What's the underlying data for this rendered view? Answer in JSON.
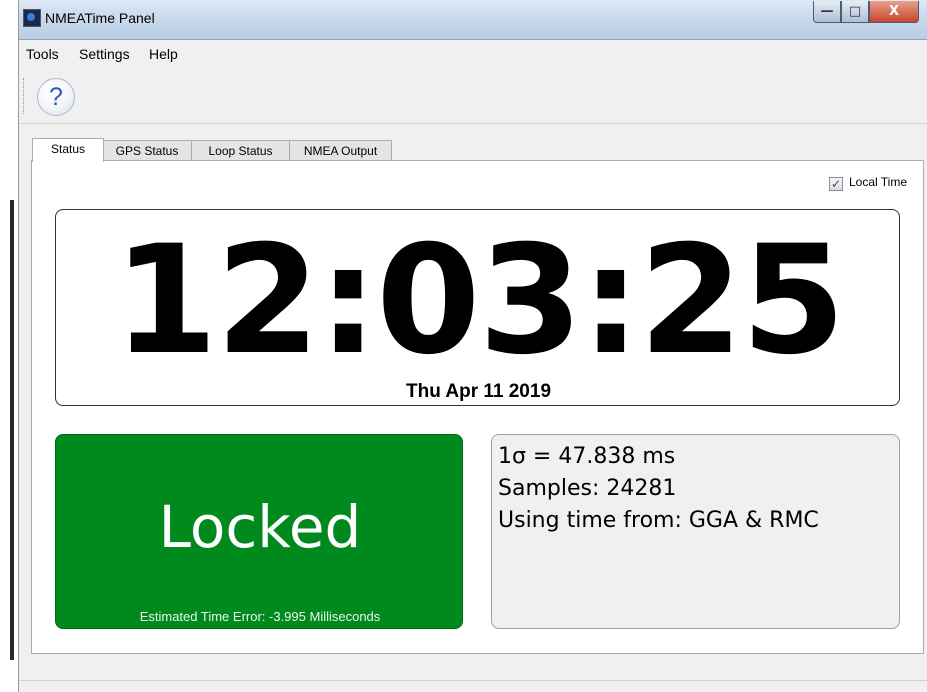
{
  "window": {
    "title": "NMEATime Panel",
    "controls": {
      "minimize": "—",
      "maximize": "□",
      "close": "X"
    }
  },
  "menu": {
    "items": [
      "Tools",
      "Settings",
      "Help"
    ]
  },
  "toolbar": {
    "help_icon": "?"
  },
  "tabs": [
    {
      "label": "Status",
      "active": true
    },
    {
      "label": "GPS Status",
      "active": false
    },
    {
      "label": "Loop Status",
      "active": false
    },
    {
      "label": "NMEA Output",
      "active": false
    }
  ],
  "status": {
    "local_time_label": "Local Time",
    "local_time_checked": true,
    "checkmark": "✓",
    "time": "12:03:25",
    "date": "Thu Apr 11 2019",
    "lock_state": "Locked",
    "estimated_error": "Estimated Time Error: -3.995 Milliseconds",
    "sigma": "1σ = 47.838 ms",
    "samples": "Samples: 24281",
    "time_source": "Using time from: GGA & RMC"
  },
  "colors": {
    "locked_bg": "#008a1e",
    "accent_blue": "#2c58b8"
  }
}
